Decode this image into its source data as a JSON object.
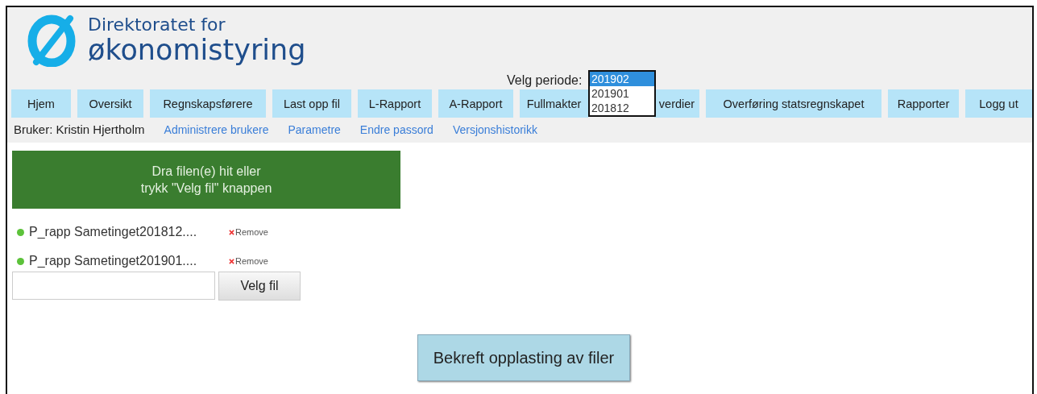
{
  "logo": {
    "line1": "Direktoratet for",
    "line2": "økonomistyring"
  },
  "period": {
    "label": "Velg periode:",
    "options": [
      {
        "label": "201902",
        "selected": true
      },
      {
        "label": "201901",
        "selected": false
      },
      {
        "label": "201812",
        "selected": false
      }
    ]
  },
  "nav": [
    {
      "label": "Hjem"
    },
    {
      "label": "Oversikt"
    },
    {
      "label": "Regnskapsførere"
    },
    {
      "label": "Last opp fil"
    },
    {
      "label": "L-Rapport"
    },
    {
      "label": "A-Rapport"
    },
    {
      "label": "Fullmakter"
    },
    {
      "label": "verdier"
    },
    {
      "label": "Overføring statsregnskapet"
    },
    {
      "label": "Rapporter"
    },
    {
      "label": "Logg ut"
    }
  ],
  "user": {
    "label": "Bruker: Kristin Hjertholm",
    "links": [
      "Administrere brukere",
      "Parametre",
      "Endre passord",
      "Versjonshistorikk"
    ]
  },
  "dropzone": {
    "line1": "Dra filen(e) hit eller",
    "line2": "trykk \"Velg fil\" knappen"
  },
  "files": [
    {
      "name": "P_rapp Sametinget201812....",
      "remove": "Remove"
    },
    {
      "name": "P_rapp Sametinget201901....",
      "remove": "Remove"
    }
  ],
  "file_picker": {
    "button": "Velg fil"
  },
  "confirm_button": "Bekreft opplasting av filer"
}
